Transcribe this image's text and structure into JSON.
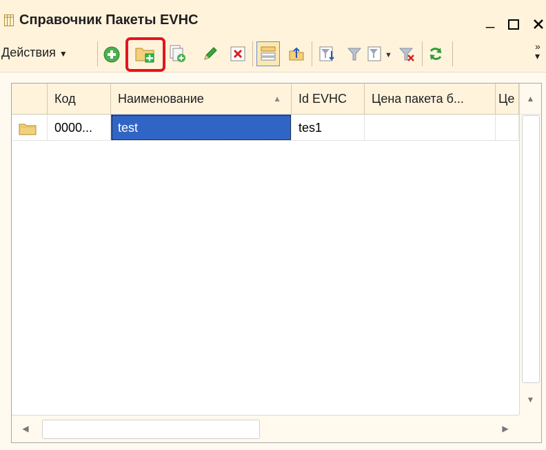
{
  "window": {
    "title": "Справочник Пакеты EVHC"
  },
  "toolbar": {
    "actions_label": "Действия",
    "buttons": [
      "add-icon",
      "add-folder-icon",
      "copy-icon",
      "edit-icon",
      "delete-icon",
      "hierarchy-icon",
      "level-up-icon",
      "filter-settings-icon",
      "filter-icon",
      "filter-dropdown-icon",
      "clear-filter-icon",
      "refresh-icon",
      "more-icon"
    ],
    "highlight_color": "#e4151c"
  },
  "table": {
    "columns": [
      "Код",
      "Наименование",
      "Id EVHC",
      "Цена пакета б...",
      "Це"
    ],
    "rows": [
      {
        "icon": "folder-icon",
        "code": "0000...",
        "name": "test",
        "id": "tes1",
        "price": "",
        "price2": ""
      }
    ]
  },
  "colors": {
    "selection": "#3165c5",
    "toolbar_bg": "#fff3dc",
    "folder": "#f3d07a"
  }
}
